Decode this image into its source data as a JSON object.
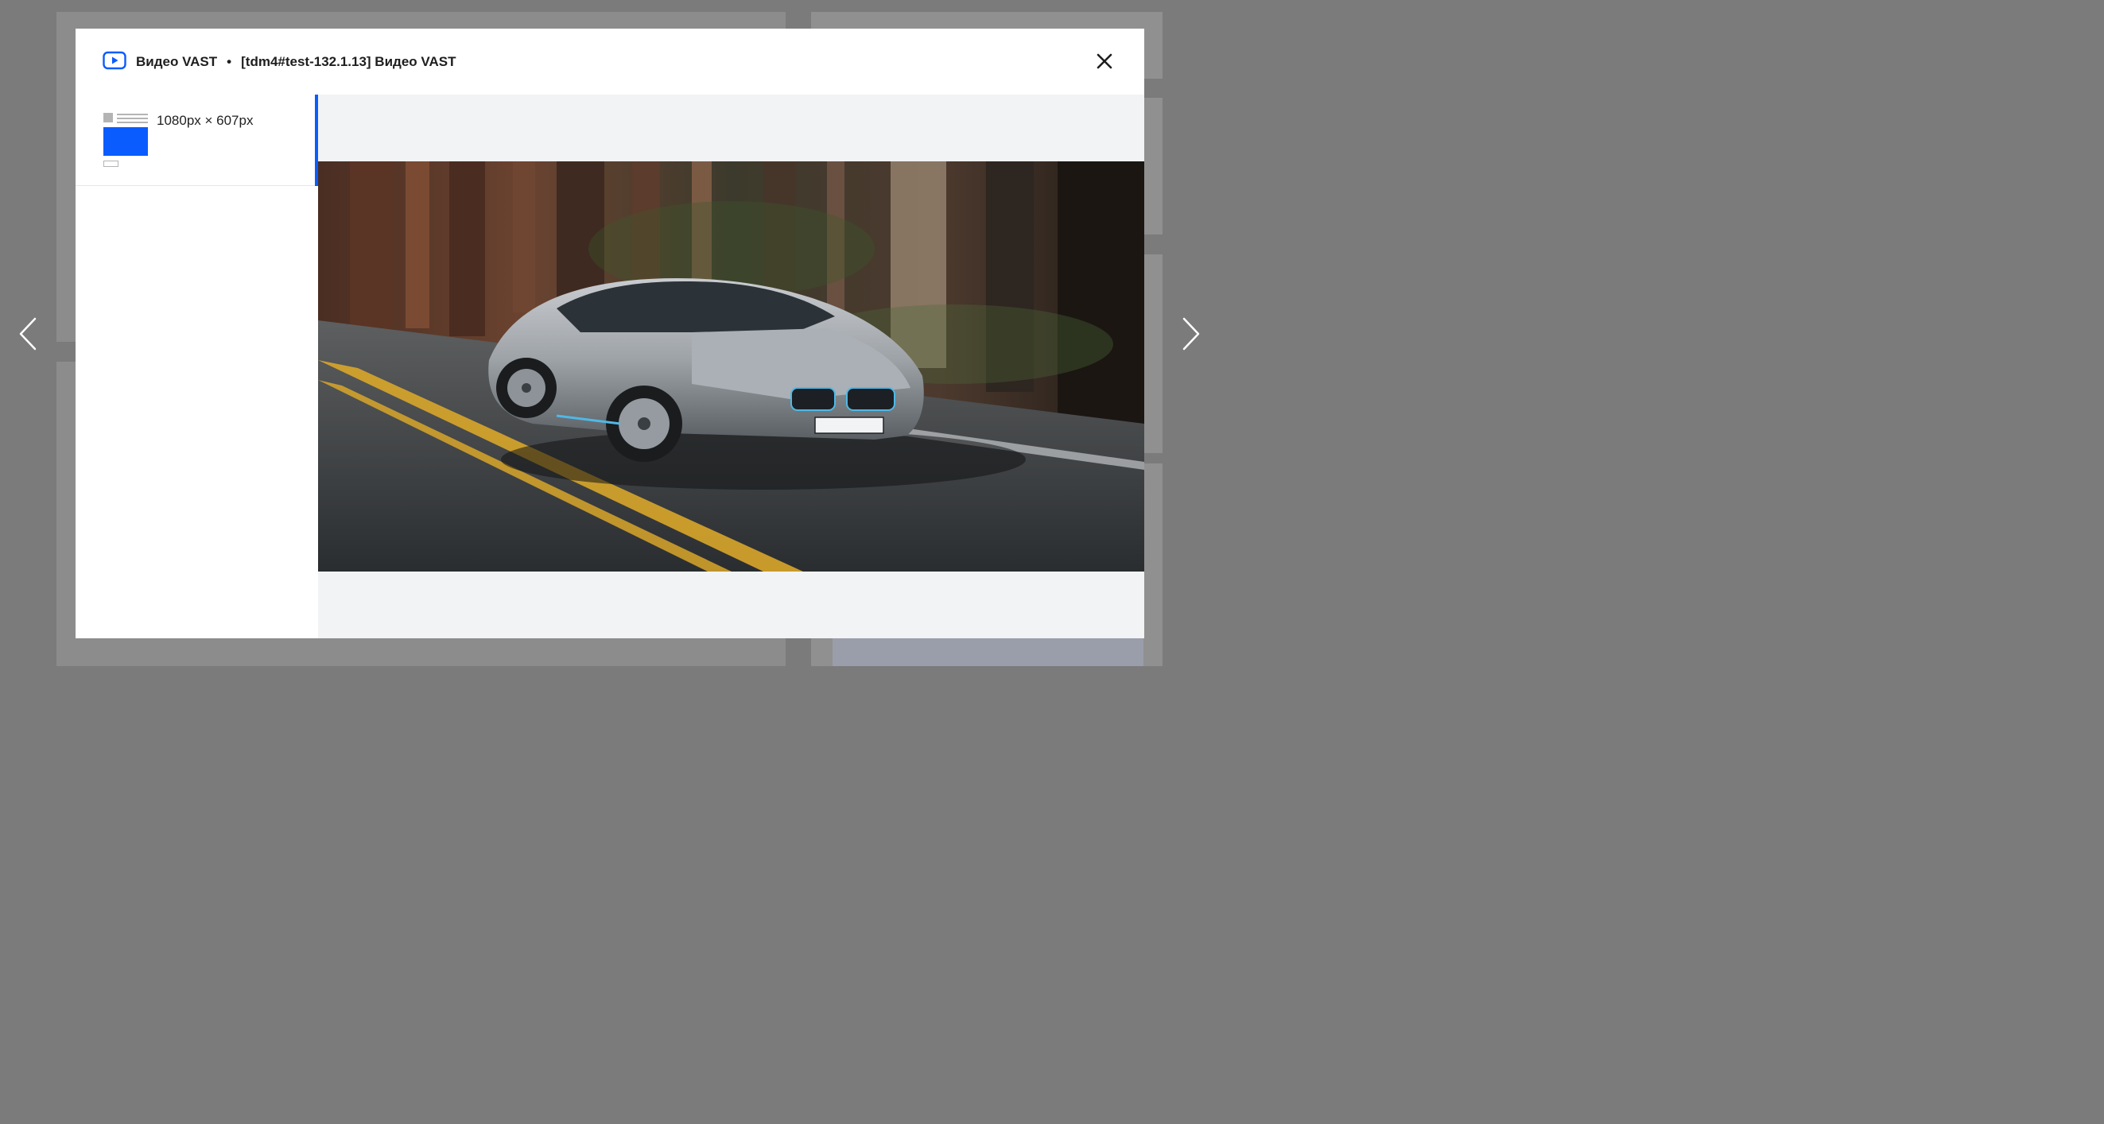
{
  "modal": {
    "format_name": "Видео VAST",
    "separator": "•",
    "creative_name": "[tdm4#test-132.1.13] Видео VAST",
    "header_icon": "video-play-icon",
    "close_icon": "close-icon"
  },
  "sidebar": {
    "items": [
      {
        "label": "1080px × 607px",
        "active": true
      }
    ]
  },
  "navigation": {
    "prev_icon": "chevron-left-icon",
    "next_icon": "chevron-right-icon"
  },
  "colors": {
    "accent": "#0a5cff",
    "overlay": "#7b7b7b",
    "preview_bg": "#f2f3f5"
  }
}
